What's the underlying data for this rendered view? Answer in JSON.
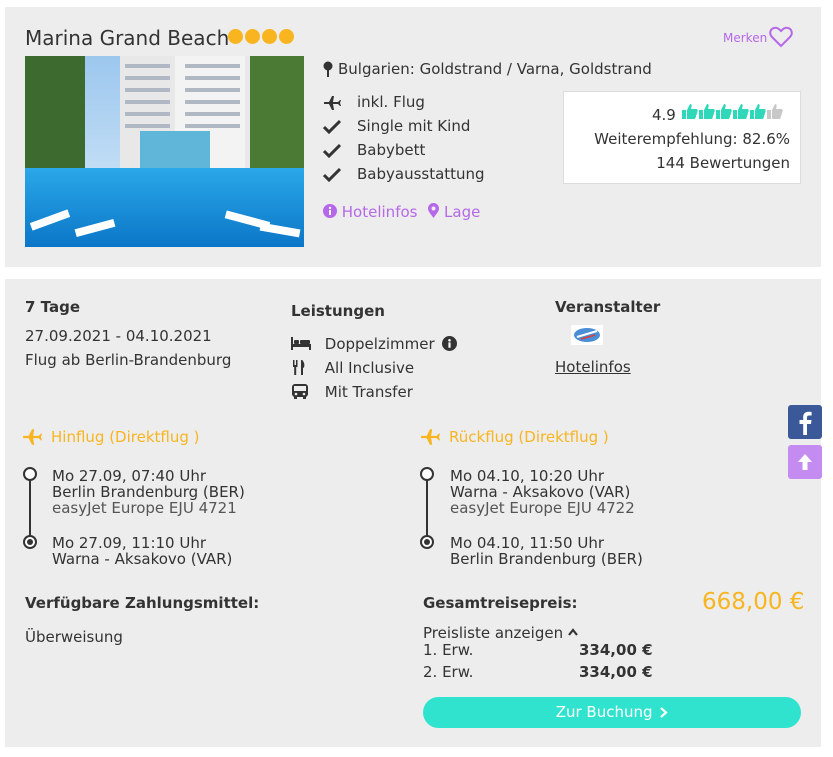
{
  "hotel": {
    "name": "Marina Grand Beach",
    "stars": 4,
    "location": "Bulgarien: Goldstrand / Varna, Goldstrand",
    "merken_label": "Merken",
    "features": [
      "inkl. Flug",
      "Single mit Kind",
      "Babybett",
      "Babyausstattung"
    ],
    "hotelinfos_link": "Hotelinfos",
    "lage_link": "Lage",
    "rating": {
      "score": "4.9",
      "thumbs_filled": 5,
      "thumbs_total": 6,
      "recommendation": "Weiterempfehlung: 82.6%",
      "reviews": "144 Bewertungen"
    }
  },
  "offer": {
    "duration": "7 Tage",
    "dates": "27.09.2021 - 04.10.2021",
    "departure": "Flug ab Berlin-Brandenburg",
    "services_heading": "Leistungen",
    "services": [
      "Doppelzimmer",
      "All Inclusive",
      "Mit Transfer"
    ],
    "operator_heading": "Veranstalter",
    "operator_link": "Hotelinfos"
  },
  "outbound": {
    "title": "Hinflug (Direktflug )",
    "dep_time": "Mo 27.09, 07:40 Uhr",
    "dep_airport": "Berlin Brandenburg (BER)",
    "airline": "easyJet Europe EJU 4721",
    "arr_time": "Mo 27.09, 11:10 Uhr",
    "arr_airport": "Warna - Aksakovo (VAR)"
  },
  "return": {
    "title": "Rückflug (Direktflug )",
    "dep_time": "Mo 04.10, 10:20 Uhr",
    "dep_airport": "Warna - Aksakovo (VAR)",
    "airline": "easyJet Europe EJU 4722",
    "arr_time": "Mo 04.10, 11:50 Uhr",
    "arr_airport": "Berlin Brandenburg (BER)"
  },
  "payment": {
    "heading": "Verfügbare Zahlungsmittel:",
    "method": "Überweisung"
  },
  "price": {
    "heading": "Gesamtreisepreis:",
    "total": "668,00 €",
    "toggle": "Preisliste anzeigen",
    "rows": [
      {
        "label": "1. Erw.",
        "amount": "334,00 €"
      },
      {
        "label": "2. Erw.",
        "amount": "334,00 €"
      }
    ],
    "button": "Zur Buchung"
  },
  "colors": {
    "accent_orange": "#f8b520",
    "accent_purple": "#b568e8",
    "button_teal": "#2fe3cf",
    "thumb_green": "#2fd8b8",
    "facebook": "#3b5998"
  },
  "icons": {
    "facebook": "facebook-icon",
    "scroll_top": "arrow-up-icon"
  }
}
